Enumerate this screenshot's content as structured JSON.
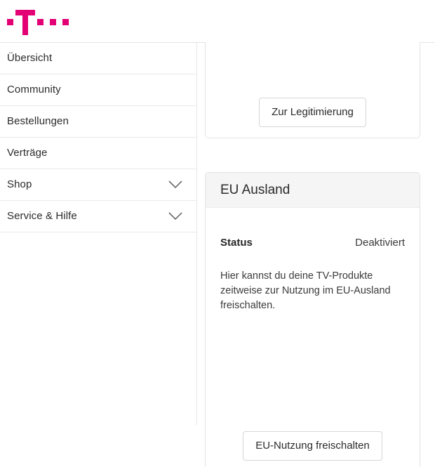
{
  "header": {
    "logo_name": "telekom-logo",
    "logo_alt": "Telekom",
    "brand_color": "#e20074"
  },
  "sidebar": {
    "items": [
      {
        "label": "Übersicht",
        "has_chevron": false,
        "icon": null
      },
      {
        "label": "Community",
        "has_chevron": false,
        "icon": null
      },
      {
        "label": "Bestellungen",
        "has_chevron": false,
        "icon": null
      },
      {
        "label": "Verträge",
        "has_chevron": false,
        "icon": null
      },
      {
        "label": "Shop",
        "has_chevron": true,
        "icon": "chevron-down-icon"
      },
      {
        "label": "Service & Hilfe",
        "has_chevron": true,
        "icon": "chevron-down-icon"
      }
    ]
  },
  "main": {
    "legitimation_card": {
      "button_label": "Zur Legitimierung"
    },
    "eu_card": {
      "title": "EU Ausland",
      "status_label": "Status",
      "status_value": "Deaktiviert",
      "description": "Hier kannst du deine TV-Produkte zeitweise zur Nutzung im EU-Ausland freischalten.",
      "button_label": "EU-Nutzung freischalten"
    }
  }
}
